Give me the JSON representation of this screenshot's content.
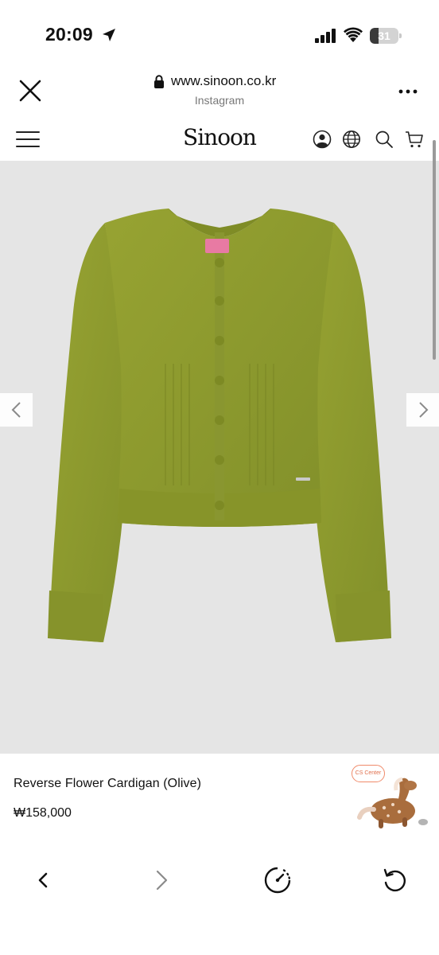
{
  "status_bar": {
    "time": "20:09",
    "battery_level": "31",
    "battery_fraction": 0.31
  },
  "browser": {
    "url": "www.sinoon.co.kr",
    "source_label": "Instagram"
  },
  "site": {
    "logo": "Sinoon",
    "nav_icons": [
      "user-icon",
      "globe-icon",
      "search-icon",
      "cart-icon"
    ]
  },
  "product": {
    "name": "Reverse Flower Cardigan (Olive)",
    "price": "₩158,000",
    "color_hex": "#8d9a2d",
    "cs_label": "CS Center"
  },
  "colors": {
    "gallery_background": "#e5e5e5",
    "cardigan_olive": "#8d9a2d",
    "cs_accent": "#f08a6a"
  }
}
